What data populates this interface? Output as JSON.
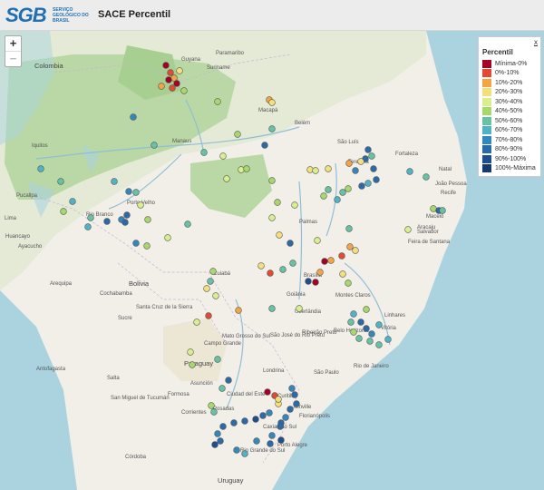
{
  "header": {
    "logo_text": "SGB",
    "logo_subtitle": "SERVIÇO GEOLÓGICO DO BRASIL",
    "title": "SACE Percentil"
  },
  "zoom": {
    "in_label": "+",
    "out_label": "−"
  },
  "legend": {
    "title": "Percentil",
    "close_label": "x",
    "items": [
      {
        "label": "Mínima-0%",
        "color": "#a50026"
      },
      {
        "label": "0%-10%",
        "color": "#e34a33"
      },
      {
        "label": "10%-20%",
        "color": "#f4a442"
      },
      {
        "label": "20%-30%",
        "color": "#f3e07a"
      },
      {
        "label": "30%-40%",
        "color": "#d9ef8b"
      },
      {
        "label": "40%-50%",
        "color": "#a6d96a"
      },
      {
        "label": "50%-60%",
        "color": "#66c2a5"
      },
      {
        "label": "60%-70%",
        "color": "#4fb3c8"
      },
      {
        "label": "70%-80%",
        "color": "#3288bd"
      },
      {
        "label": "80%-90%",
        "color": "#2b6aa8"
      },
      {
        "label": "90%-100%",
        "color": "#1f4e8c"
      },
      {
        "label": "100%-Máxima",
        "color": "#163a6e"
      }
    ]
  },
  "map_labels": [
    "Guyana",
    "Paramaribo",
    "Suriname",
    "Colombia",
    "Macapá",
    "Belém",
    "São Luís",
    "Iquitos",
    "Manaus",
    "Fortaleza",
    "Natal",
    "Teresina",
    "João Pessoa",
    "Recife",
    "Maceió",
    "Aracaju",
    "Palmas",
    "Porto Velho",
    "Rio Branco",
    "Pucallpa",
    "Huancayo",
    "Ayacucho",
    "Salvador",
    "Feira de Santana",
    "Brasília",
    "Goiânia",
    "Cuiabá",
    "Montes Claros",
    "Bolivia",
    "Arequipa",
    "Cochabamba",
    "Santa Cruz de la Sierra",
    "Belo Horizonte",
    "Vitória",
    "Uberlândia",
    "Ribeirão Preto",
    "São José do Rio Preto",
    "Campo Grande",
    "Rio de Janeiro",
    "São Paulo",
    "Paraguay",
    "Asunción",
    "Ciudad del Este",
    "Londrina",
    "Curitiba",
    "Florianópolis",
    "Caxias do Sul",
    "Porto Alegre",
    "Rio Grande do Sul",
    "Antofagasta",
    "San Miguel de Tucumán",
    "Salta",
    "Corrientes",
    "Córdoba",
    "Uruguay",
    "Formosa",
    "Posadas",
    "Mato Grosso do Sul",
    "Linhares",
    "Lima",
    "Sucre",
    "Joinville"
  ]
}
